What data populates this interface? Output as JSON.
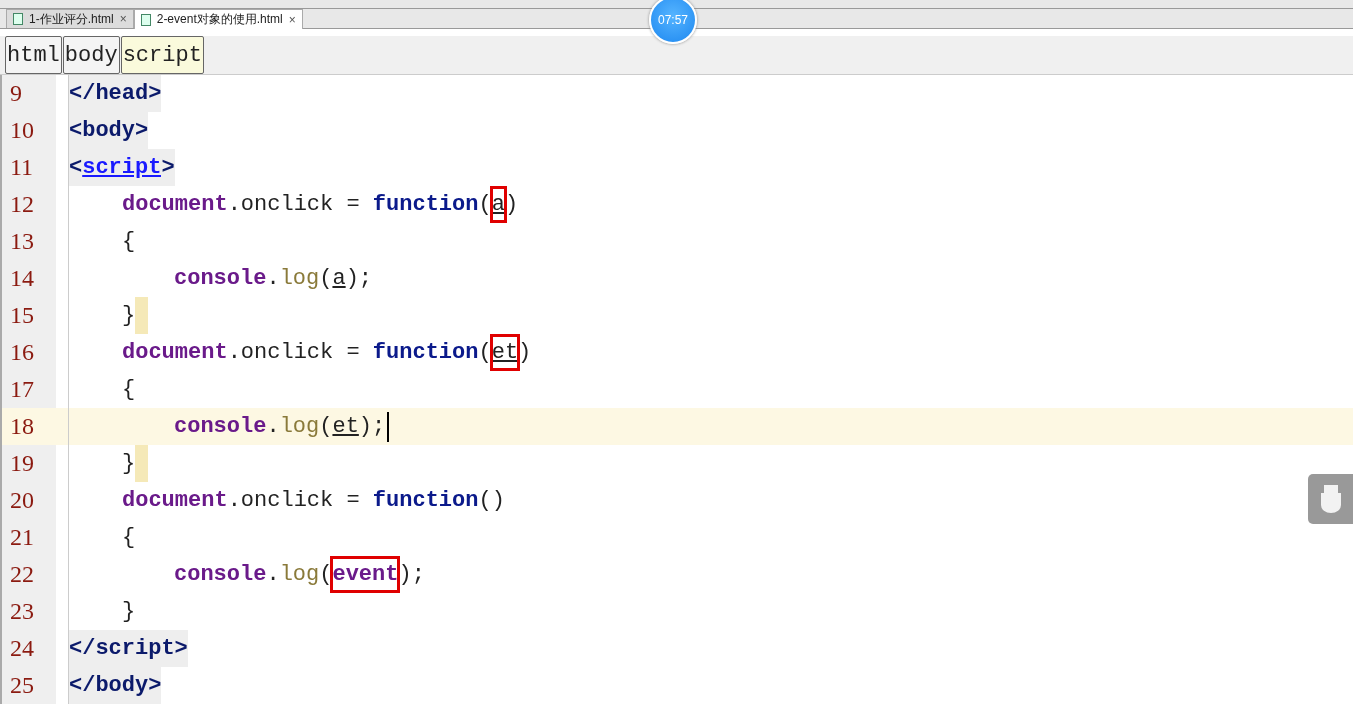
{
  "tabs": [
    {
      "label": "1-作业评分.html",
      "close": "×",
      "selected": false
    },
    {
      "label": "2-event对象的使用.html",
      "close": "×",
      "selected": true
    }
  ],
  "timer": "07:57",
  "breadcrumb": [
    {
      "label": "html",
      "selected": false
    },
    {
      "label": "body",
      "selected": false
    },
    {
      "label": "script",
      "selected": true
    }
  ],
  "code_lines": [
    {
      "number": "9",
      "kind": "tag",
      "current": false,
      "brace_highlight": false,
      "tokens": [
        {
          "kind": "tag",
          "text": "</head>"
        }
      ]
    },
    {
      "number": "10",
      "kind": "tag",
      "current": false,
      "brace_highlight": false,
      "tokens": [
        {
          "kind": "tag",
          "text": "<body>"
        }
      ]
    },
    {
      "number": "11",
      "kind": "tag",
      "current": false,
      "brace_highlight": false,
      "tokens": [
        {
          "kind": "tag",
          "text": "<"
        },
        {
          "kind": "tag-link",
          "text": "script"
        },
        {
          "kind": "tag",
          "text": ">"
        }
      ]
    },
    {
      "number": "12",
      "kind": "statement",
      "current": false,
      "brace_highlight": false,
      "tokens": [
        {
          "kind": "object",
          "text": "document"
        },
        {
          "kind": "plain",
          "text": ".onclick = "
        },
        {
          "kind": "keyword",
          "text": "function"
        },
        {
          "kind": "plain",
          "text": "("
        },
        {
          "kind": "param-boxed",
          "text": "a"
        },
        {
          "kind": "plain",
          "text": ")"
        }
      ]
    },
    {
      "number": "13",
      "kind": "statement",
      "current": false,
      "brace_highlight": false,
      "tokens": [
        {
          "kind": "plain",
          "text": "{"
        }
      ]
    },
    {
      "number": "14",
      "kind": "inner",
      "current": false,
      "brace_highlight": false,
      "tokens": [
        {
          "kind": "object",
          "text": "console"
        },
        {
          "kind": "plain",
          "text": "."
        },
        {
          "kind": "method",
          "text": "log"
        },
        {
          "kind": "plain",
          "text": "("
        },
        {
          "kind": "param",
          "text": "a"
        },
        {
          "kind": "plain",
          "text": ");"
        }
      ]
    },
    {
      "number": "15",
      "kind": "statement",
      "current": false,
      "brace_highlight": true,
      "tokens": [
        {
          "kind": "plain",
          "text": "}"
        }
      ]
    },
    {
      "number": "16",
      "kind": "statement",
      "current": false,
      "brace_highlight": false,
      "tokens": [
        {
          "kind": "object",
          "text": "document"
        },
        {
          "kind": "plain",
          "text": ".onclick = "
        },
        {
          "kind": "keyword",
          "text": "function"
        },
        {
          "kind": "plain",
          "text": "("
        },
        {
          "kind": "param-boxed",
          "text": "et"
        },
        {
          "kind": "plain",
          "text": ")"
        }
      ]
    },
    {
      "number": "17",
      "kind": "statement",
      "current": false,
      "brace_highlight": false,
      "tokens": [
        {
          "kind": "plain",
          "text": "{"
        }
      ]
    },
    {
      "number": "18",
      "kind": "inner",
      "current": true,
      "brace_highlight": false,
      "tokens": [
        {
          "kind": "object",
          "text": "console"
        },
        {
          "kind": "plain",
          "text": "."
        },
        {
          "kind": "method",
          "text": "log"
        },
        {
          "kind": "plain",
          "text": "("
        },
        {
          "kind": "param",
          "text": "et"
        },
        {
          "kind": "plain",
          "text": ");"
        }
      ]
    },
    {
      "number": "19",
      "kind": "statement",
      "current": false,
      "brace_highlight": true,
      "tokens": [
        {
          "kind": "plain",
          "text": "}"
        }
      ]
    },
    {
      "number": "20",
      "kind": "statement",
      "current": false,
      "brace_highlight": false,
      "tokens": [
        {
          "kind": "object",
          "text": "document"
        },
        {
          "kind": "plain",
          "text": ".onclick = "
        },
        {
          "kind": "keyword",
          "text": "function"
        },
        {
          "kind": "plain",
          "text": "()"
        }
      ]
    },
    {
      "number": "21",
      "kind": "statement",
      "current": false,
      "brace_highlight": false,
      "tokens": [
        {
          "kind": "plain",
          "text": "{"
        }
      ]
    },
    {
      "number": "22",
      "kind": "inner",
      "current": false,
      "brace_highlight": false,
      "tokens": [
        {
          "kind": "object",
          "text": "console"
        },
        {
          "kind": "plain",
          "text": "."
        },
        {
          "kind": "method",
          "text": "log"
        },
        {
          "kind": "plain",
          "text": "("
        },
        {
          "kind": "var-boxed",
          "text": "event"
        },
        {
          "kind": "plain",
          "text": ");"
        }
      ]
    },
    {
      "number": "23",
      "kind": "statement",
      "current": false,
      "brace_highlight": false,
      "tokens": [
        {
          "kind": "plain",
          "text": "}"
        }
      ]
    },
    {
      "number": "24",
      "kind": "tag",
      "current": false,
      "brace_highlight": false,
      "tokens": [
        {
          "kind": "tag",
          "text": "</script>"
        }
      ]
    },
    {
      "number": "25",
      "kind": "tag",
      "current": false,
      "brace_highlight": false,
      "tokens": [
        {
          "kind": "tag",
          "text": "</body>"
        }
      ]
    }
  ]
}
